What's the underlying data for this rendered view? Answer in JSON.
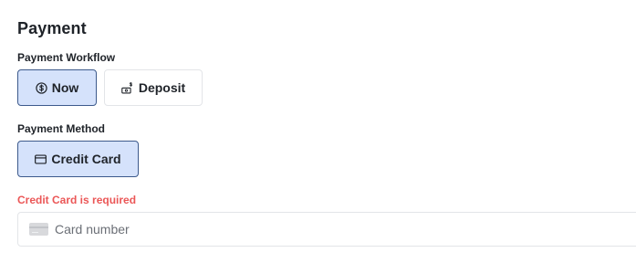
{
  "section": {
    "title": "Payment"
  },
  "workflow": {
    "label": "Payment Workflow",
    "options": [
      {
        "label": "Now",
        "icon": "dollar-coin-icon",
        "selected": true
      },
      {
        "label": "Deposit",
        "icon": "money-deposit-icon",
        "selected": false
      }
    ]
  },
  "method": {
    "label": "Payment Method",
    "options": [
      {
        "label": "Credit Card",
        "icon": "credit-card-icon",
        "selected": true
      }
    ]
  },
  "validation": {
    "error": "Credit Card is required"
  },
  "card_number": {
    "value": "",
    "placeholder": "Card number"
  },
  "colors": {
    "selected_bg": "#d5e2fb",
    "selected_border": "#3d5a8c",
    "error": "#eb5757"
  }
}
